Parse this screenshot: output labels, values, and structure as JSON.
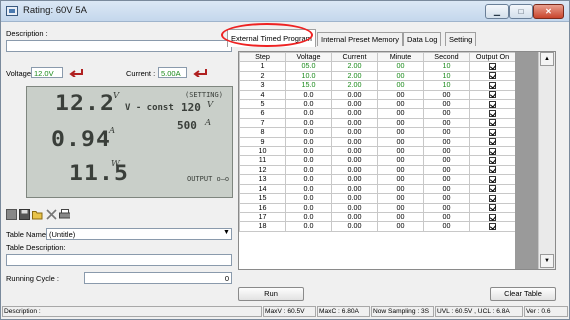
{
  "window": {
    "title": "Rating: 60V 5A",
    "min_icon": "minimize-icon",
    "max_icon": "maximize-icon",
    "close_icon": "close-icon"
  },
  "left": {
    "description_label": "Description :",
    "description_value": "",
    "voltage_label": "Voltage",
    "voltage_value": "12.0V",
    "current_label": "Current :",
    "current_value": "5.00A",
    "set_icon": "arrow-return-icon"
  },
  "lcd": {
    "voltage_readout": "12.2",
    "voltage_unit": "V",
    "current_readout": "0.94",
    "current_unit": "A",
    "power_readout": "11.5",
    "power_unit": "W",
    "setting_label": "(SETTING)",
    "mode": "V - const",
    "set_voltage": "120",
    "set_voltage_unit": "V",
    "set_current": "500",
    "set_current_unit": "A",
    "output_label": "OUTPUT o—o"
  },
  "toolbar": {
    "icons": [
      "stop-icon",
      "save-icon",
      "open-folder-icon",
      "delete-icon",
      "print-icon"
    ]
  },
  "table_name": {
    "label": "Table Name:",
    "value": "(Untitle)"
  },
  "table_description": {
    "label": "Table Description:",
    "value": ""
  },
  "running_cycle": {
    "label": "Running Cycle :",
    "value": "0"
  },
  "tabs": [
    {
      "label": "External Timed Program"
    },
    {
      "label": "Internal Preset Memory"
    },
    {
      "label": "Data Log"
    },
    {
      "label": "Setting"
    }
  ],
  "grid": {
    "headers": [
      "Step",
      "Voltage",
      "Current",
      "Minute",
      "Second",
      "Output On"
    ],
    "rows": [
      [
        "1",
        "05.0",
        "2.00",
        "00",
        "10",
        true
      ],
      [
        "2",
        "10.0",
        "2.00",
        "00",
        "10",
        true
      ],
      [
        "3",
        "15.0",
        "2.00",
        "00",
        "10",
        true
      ],
      [
        "4",
        "0.0",
        "0.00",
        "00",
        "00",
        true
      ],
      [
        "5",
        "0.0",
        "0.00",
        "00",
        "00",
        true
      ],
      [
        "6",
        "0.0",
        "0.00",
        "00",
        "00",
        true
      ],
      [
        "7",
        "0.0",
        "0.00",
        "00",
        "00",
        true
      ],
      [
        "8",
        "0.0",
        "0.00",
        "00",
        "00",
        true
      ],
      [
        "9",
        "0.0",
        "0.00",
        "00",
        "00",
        true
      ],
      [
        "10",
        "0.0",
        "0.00",
        "00",
        "00",
        true
      ],
      [
        "11",
        "0.0",
        "0.00",
        "00",
        "00",
        true
      ],
      [
        "12",
        "0.0",
        "0.00",
        "00",
        "00",
        true
      ],
      [
        "13",
        "0.0",
        "0.00",
        "00",
        "00",
        true
      ],
      [
        "14",
        "0.0",
        "0.00",
        "00",
        "00",
        true
      ],
      [
        "15",
        "0.0",
        "0.00",
        "00",
        "00",
        true
      ],
      [
        "16",
        "0.0",
        "0.00",
        "00",
        "00",
        true
      ],
      [
        "17",
        "0.0",
        "0.00",
        "00",
        "00",
        true
      ],
      [
        "18",
        "0.0",
        "0.00",
        "00",
        "00",
        true
      ]
    ]
  },
  "buttons": {
    "run": "Run",
    "clear_table": "Clear Table"
  },
  "status": {
    "description": "Description :",
    "max_v": "MaxV : 60.5V",
    "max_c": "MaxC : 6.80A",
    "sampling": "Now Sampling : 3S",
    "uvl_ucl": "UVL : 60.5V , UCL : 6.8A",
    "version": "Ver : 0.6"
  },
  "colors": {
    "accent_green": "#1a8a1a",
    "lcd_bg": "#c9cfc9",
    "highlight": "#e22222",
    "set_arrow": "#b02020"
  }
}
